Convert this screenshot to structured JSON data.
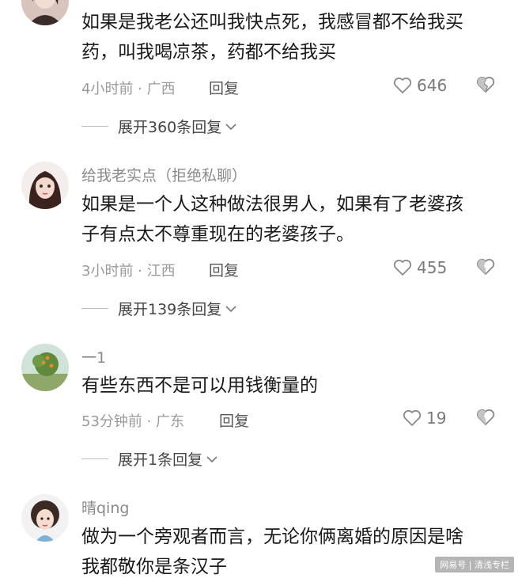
{
  "comments": [
    {
      "username": "",
      "text_lines": [
        "如果是我老公还叫我快点死，我感冒都不给我买",
        "药，叫我喝凉茶，药都不给我买"
      ],
      "time": "4小时前 · 广西",
      "reply_label": "回复",
      "likes": "646",
      "expand_label": "展开360条回复"
    },
    {
      "username": "给我老实点（拒绝私聊）",
      "text_lines": [
        "如果是一个人这种做法很男人，如果有了老婆孩",
        "子有点太不尊重现在的老婆孩子。"
      ],
      "time": "3小时前 · 江西",
      "reply_label": "回复",
      "likes": "455",
      "expand_label": "展开139条回复"
    },
    {
      "username": "一1",
      "text_lines": [
        "有些东西不是可以用钱衡量的"
      ],
      "time": "53分钟前 · 广东",
      "reply_label": "回复",
      "likes": "19",
      "expand_label": "展开1条回复"
    },
    {
      "username": "晴qing",
      "text_lines": [
        "做为一个旁观者而言，无论你俩离婚的原因是啥",
        "我都敬你是条汉子"
      ],
      "time": "",
      "reply_label": "",
      "likes": "",
      "expand_label": ""
    }
  ],
  "watermark": "网易号 | 清浅专栏",
  "icons": {
    "like": "heart-outline-icon",
    "dislike": "broken-heart-icon",
    "expand": "chevron-down-icon"
  },
  "colors": {
    "text": "#1a1a1a",
    "meta": "#9a9a9a",
    "username": "#8a8a8a"
  }
}
